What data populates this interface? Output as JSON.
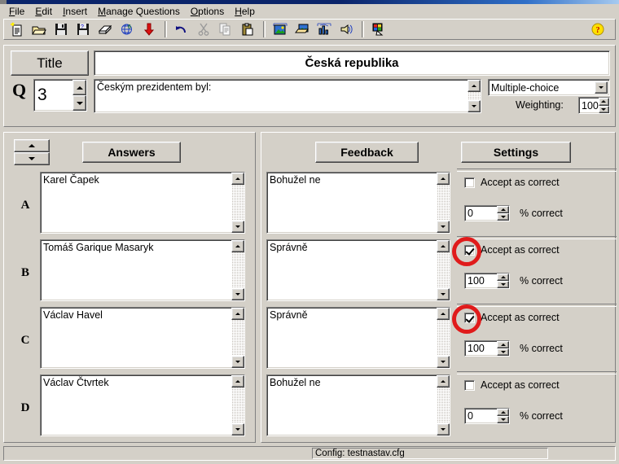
{
  "menubar": {
    "items": [
      {
        "label": "File",
        "accel": "F"
      },
      {
        "label": "Edit",
        "accel": "E"
      },
      {
        "label": "Insert",
        "accel": "I"
      },
      {
        "label": "Manage Questions",
        "accel": "M"
      },
      {
        "label": "Options",
        "accel": "O"
      },
      {
        "label": "Help",
        "accel": "H"
      }
    ]
  },
  "toolbar": {
    "groups": [
      [
        "new-document-icon",
        "open-folder-icon",
        "save-floppy-icon",
        "save-as-floppy-icon",
        "eraser-icon",
        "web-export-icon",
        "red-down-arrow-icon"
      ],
      [
        "undo-arrow-icon",
        "cut-scissors-icon",
        "copy-pages-icon",
        "paste-clipboard-icon"
      ],
      [
        "insert-image-icon",
        "open-image-icon",
        "insert-chart-icon",
        "insert-sound-icon"
      ],
      [
        "colors-palette-icon"
      ]
    ],
    "help_icon": "help-question-icon"
  },
  "header": {
    "title_button_label": "Title",
    "title_value": "Česká republika",
    "q_label": "Q",
    "q_number": "3",
    "question_text": "Českým prezidentem byl:",
    "question_type": "Multiple-choice",
    "weighting_label": "Weighting:",
    "weighting_value": "100"
  },
  "panels": {
    "answers_header": "Answers",
    "feedback_header": "Feedback",
    "settings_header": "Settings",
    "sorter_up_icon": "sort-up-icon",
    "sorter_down_icon": "sort-down-icon"
  },
  "rows": [
    {
      "letter": "A",
      "answer": "Karel Čapek",
      "feedback": "Bohužel ne",
      "accept_label": "Accept as correct",
      "accepted": false,
      "percent": "0",
      "percent_label": "% correct",
      "highlighted": false
    },
    {
      "letter": "B",
      "answer": "Tomáš Garique Masaryk",
      "feedback": "Správně",
      "accept_label": "Accept as correct",
      "accepted": true,
      "percent": "100",
      "percent_label": "% correct",
      "highlighted": true
    },
    {
      "letter": "C",
      "answer": "Václav Havel",
      "feedback": "Správně",
      "accept_label": "Accept as correct",
      "accepted": true,
      "percent": "100",
      "percent_label": "% correct",
      "highlighted": true
    },
    {
      "letter": "D",
      "answer": "Václav Čtvrtek",
      "feedback": "Bohužel ne",
      "accept_label": "Accept as correct",
      "accepted": false,
      "percent": "0",
      "percent_label": "% correct",
      "highlighted": false
    }
  ],
  "statusbar": {
    "config_text": "Config: testnastav.cfg"
  },
  "colors": {
    "face": "#d4d0c8",
    "title_bar": "#0a246a",
    "annotation_ring": "#e01b1b",
    "field_bg": "#ffffff"
  }
}
